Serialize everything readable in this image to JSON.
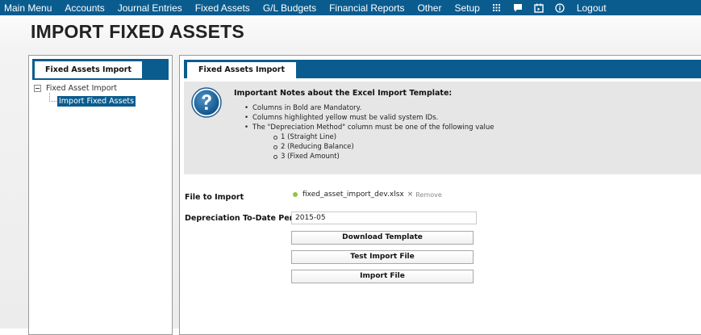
{
  "nav": {
    "items": [
      "Main Menu",
      "Accounts",
      "Journal Entries",
      "Fixed Assets",
      "G/L Budgets",
      "Financial Reports",
      "Other",
      "Setup"
    ],
    "logout": "Logout",
    "icons": [
      "grid-icon",
      "chat-icon",
      "calendar-icon",
      "info-icon"
    ],
    "bg_color": "#0a5c8f"
  },
  "page": {
    "title": "IMPORT FIXED ASSETS"
  },
  "left": {
    "tab": "Fixed Assets Import",
    "tree_root": "Fixed Asset Import",
    "tree_child": "Import Fixed Assets"
  },
  "right": {
    "tab": "Fixed Assets Import",
    "notes": {
      "title": "Important Notes about the Excel Import Template:",
      "items": [
        "Columns in Bold are Mandatory.",
        "Columns highlighted yellow must be valid system IDs.",
        "The \"Depreciation Method\" column must be one of the following value"
      ],
      "sub_items": [
        "1 (Straight Line)",
        "2 (Reducing Balance)",
        "3 (Fixed Amount)"
      ]
    },
    "form": {
      "file_label": "File to Import",
      "file_name": "fixed_asset_import_dev.xlsx",
      "remove_x": "×",
      "remove_label": "Remove",
      "period_label": "Depreciation To-Date Period",
      "period_value": "2015-05",
      "download_btn": "Download Template",
      "test_btn": "Test Import File",
      "import_btn": "Import File"
    }
  }
}
